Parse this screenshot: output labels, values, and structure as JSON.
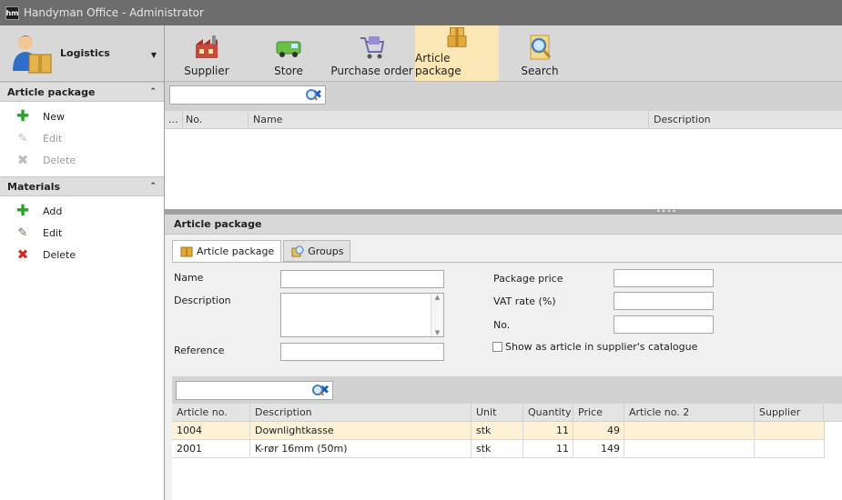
{
  "window": {
    "logo": "hm",
    "title": "Handyman Office - Administrator"
  },
  "sidebar": {
    "role": "Logistics",
    "sections": [
      {
        "title": "Article package",
        "items": [
          {
            "label": "New",
            "icon": "plus-icon",
            "enabled": true
          },
          {
            "label": "Edit",
            "icon": "edit-icon",
            "enabled": false
          },
          {
            "label": "Delete",
            "icon": "delete-icon",
            "enabled": false
          }
        ]
      },
      {
        "title": "Materials",
        "items": [
          {
            "label": "Add",
            "icon": "plus-icon",
            "enabled": true
          },
          {
            "label": "Edit",
            "icon": "edit-icon",
            "enabled": true
          },
          {
            "label": "Delete",
            "icon": "delete-icon",
            "enabled": true
          }
        ]
      }
    ]
  },
  "toolbar": {
    "items": [
      {
        "label": "Supplier",
        "icon": "factory-icon"
      },
      {
        "label": "Store",
        "icon": "van-icon"
      },
      {
        "label": "Purchase order",
        "icon": "shopping-cart-icon"
      },
      {
        "label": "Article package",
        "icon": "package-icon",
        "active": true
      },
      {
        "label": "Search",
        "icon": "search-icon"
      }
    ]
  },
  "upper_grid": {
    "search_value": "",
    "columns": [
      "...",
      "No.",
      "Name",
      "Description"
    ]
  },
  "detail": {
    "title": "Article package",
    "tabs": [
      "Article package",
      "Groups"
    ],
    "form": {
      "name_label": "Name",
      "description_label": "Description",
      "reference_label": "Reference",
      "package_price_label": "Package price",
      "vat_rate_label": "VAT rate (%)",
      "no_label": "No.",
      "show_in_catalogue_label": "Show as article in supplier's catalogue",
      "show_in_catalogue_checked": false,
      "name_value": "",
      "description_value": "",
      "reference_value": "",
      "package_price_value": "",
      "vat_rate_value": "",
      "no_value": ""
    },
    "materials_grid": {
      "search_value": "",
      "columns": [
        "Article no.",
        "Description",
        "Unit",
        "Quantity",
        "Price",
        "Article no. 2",
        "Supplier"
      ],
      "rows": [
        {
          "article_no": "1004",
          "description": "Downlightkasse",
          "unit": "stk",
          "quantity": "11",
          "price": "49",
          "article_no_2": "",
          "supplier": ""
        },
        {
          "article_no": "2001",
          "description": "K-rør 16mm (50m)",
          "unit": "stk",
          "quantity": "11",
          "price": "149",
          "article_no_2": "",
          "supplier": ""
        }
      ]
    }
  },
  "colors": {
    "active_tool": "#fbe6b6",
    "selected_row": "#fdf1d8",
    "titlebar": "#6d6d6d"
  }
}
